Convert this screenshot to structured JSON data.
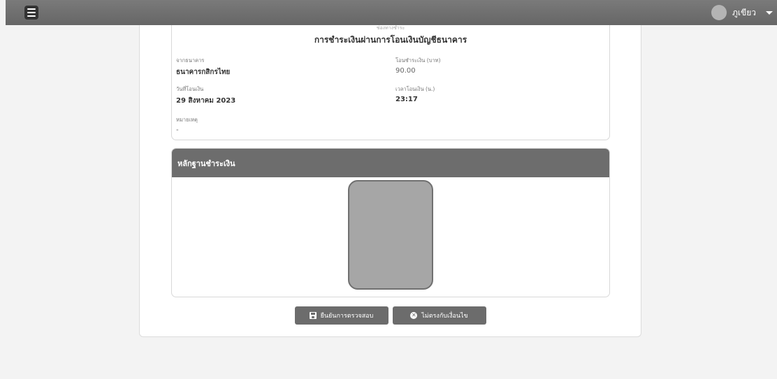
{
  "header": {
    "user_name": "ภูเขียว"
  },
  "info": {
    "faded_title": "ช่องทางชำระ",
    "title": "การชำระเงินผ่านการโอนเงินบัญชีธนาคาร",
    "from_bank_label": "จากธนาคาร",
    "from_bank_value": "ธนาคารกสิกรไทย",
    "amount_label": "โอนชำระเงิน (บาท)",
    "amount_value": "90.00",
    "date_label": "วันที่โอนเงิน",
    "date_value": "29 สิงหาคม 2023",
    "time_label": "เวลาโอนเงิน (น.)",
    "time_value": "23:17",
    "note_label": "หมายเหตุ",
    "note_value": "-"
  },
  "proof": {
    "title": "หลักฐานชำระเงิน"
  },
  "actions": {
    "confirm_label": "ยืนยันการตรวจสอบ",
    "reject_label": "ไม่ตรงกับเงื่อนไข"
  }
}
